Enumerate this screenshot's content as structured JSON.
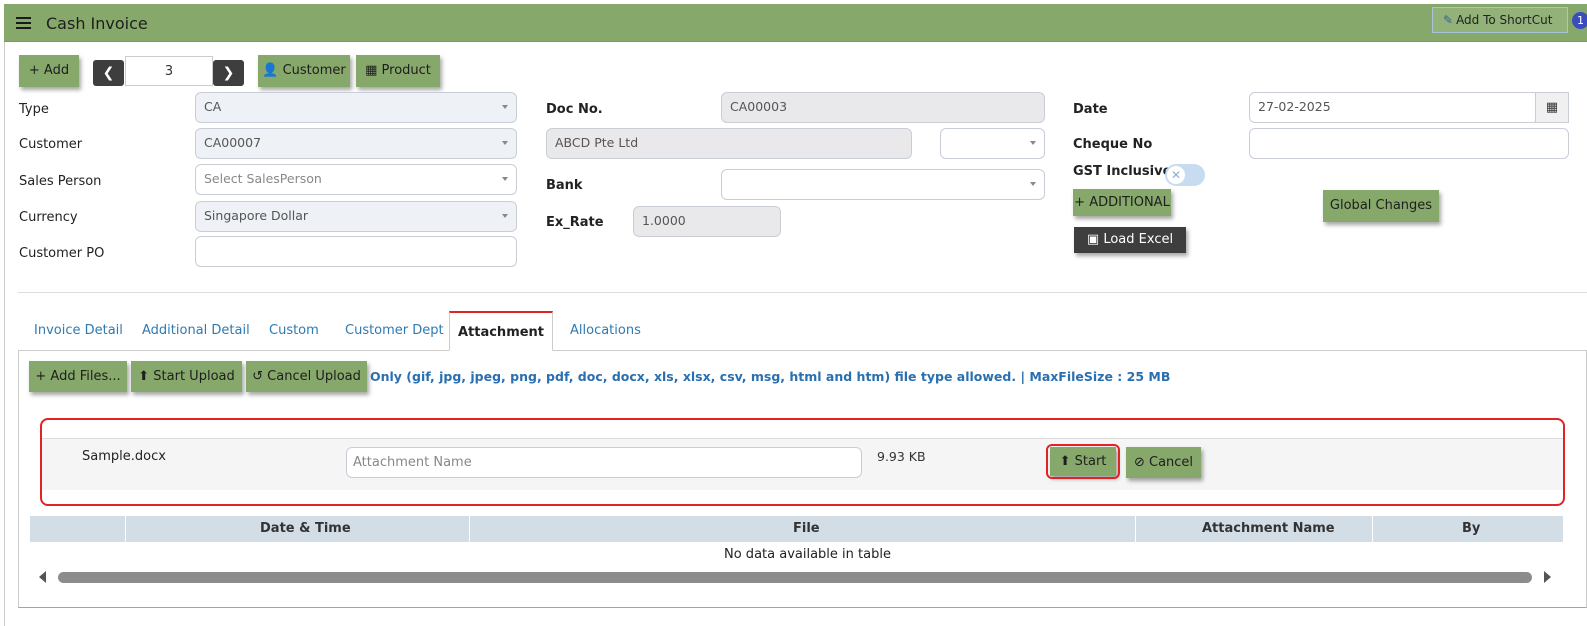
{
  "header": {
    "title": "Cash Invoice",
    "shortcut_label": "Add To ShortCut",
    "shortcut_badge": "1"
  },
  "toolbar": {
    "add_label": "+ Add",
    "record_number": "3",
    "customer_label": "Customer",
    "product_label": "Product"
  },
  "form": {
    "type_label": "Type",
    "type_value": "CA",
    "customer_label": "Customer",
    "customer_value": "CA00007",
    "sales_person_label": "Sales Person",
    "sales_person_placeholder": "Select SalesPerson",
    "currency_label": "Currency",
    "currency_value": "Singapore Dollar",
    "customer_po_label": "Customer PO",
    "customer_po_value": "",
    "doc_no_label": "Doc No.",
    "doc_no_value": "CA00003",
    "customer_name": "ABCD Pte Ltd",
    "bank_label": "Bank",
    "bank_value": "",
    "ex_rate_label": "Ex_Rate",
    "ex_rate_value": "1.0000",
    "date_label": "Date",
    "date_value": "27-02-2025",
    "cheque_no_label": "Cheque No",
    "cheque_no_value": "",
    "gst_inclusive_label": "GST Inclusive",
    "additional_label": "+ ADDITIONAL",
    "load_excel_label": "Load Excel",
    "global_changes_label": "Global Changes"
  },
  "tabs": [
    {
      "label": "Invoice Detail"
    },
    {
      "label": "Additional Detail"
    },
    {
      "label": "Custom"
    },
    {
      "label": "Customer Dept"
    },
    {
      "label": "Attachment"
    },
    {
      "label": "Allocations"
    }
  ],
  "attachment": {
    "add_files_label": "+ Add Files...",
    "start_upload_label": "Start Upload",
    "cancel_upload_label": "Cancel Upload",
    "note": "Only (gif, jpg, jpeg, png, pdf, doc, docx, xls, xlsx, csv, msg, html and htm) file type allowed. | MaxFileSize : 25 MB",
    "file": {
      "name": "Sample.docx",
      "attachment_name_placeholder": "Attachment Name",
      "size": "9.93 KB",
      "start_label": "Start",
      "cancel_label": "Cancel"
    },
    "table": {
      "columns": [
        "Date & Time",
        "File",
        "Attachment Name",
        "By"
      ],
      "empty_message": "No data available in table"
    }
  }
}
